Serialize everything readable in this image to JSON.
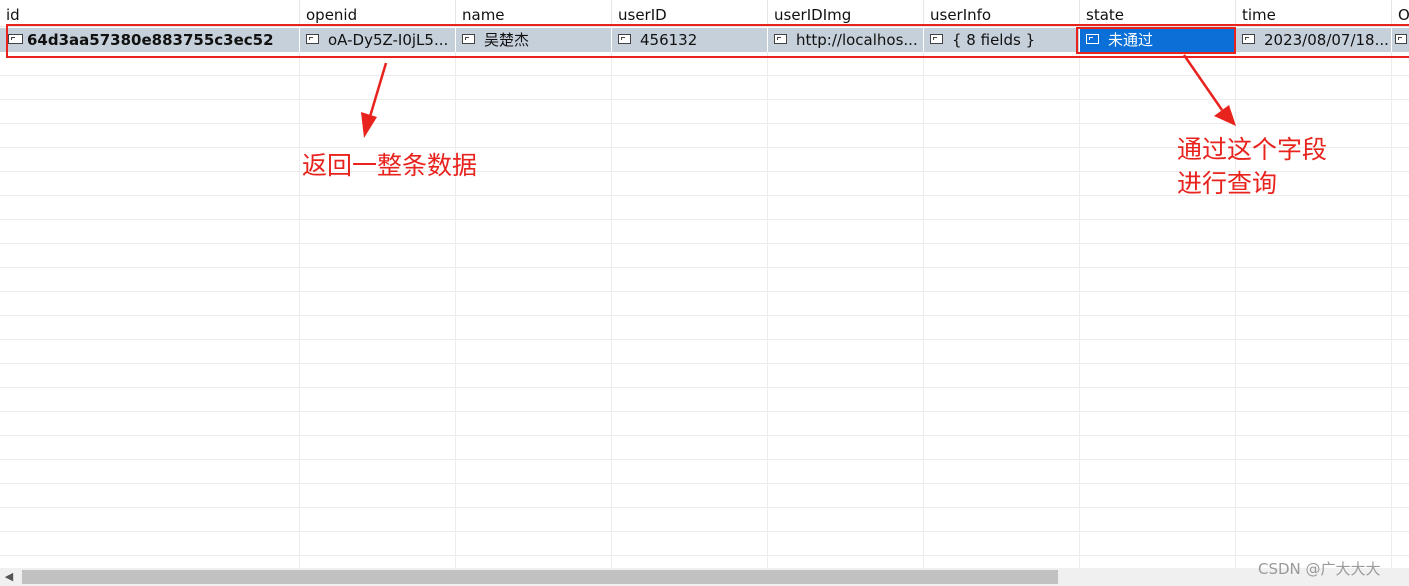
{
  "grid": {
    "columns": [
      "id",
      "openid",
      "name",
      "userID",
      "userIDImg",
      "userInfo",
      "state",
      "time",
      "O"
    ],
    "row": {
      "id": "64d3aa57380e883755c3ec52",
      "openid": "oA-Dy5Z-I0jL5...",
      "name": "吴楚杰",
      "userID": "456132",
      "userIDImg": "http://localhos...",
      "userInfo": "{ 8 fields }",
      "state": "未通过",
      "time": "2023/08/07/18..."
    }
  },
  "annotations": {
    "left": "返回一整条数据",
    "right_line1": "通过这个字段",
    "right_line2": "进行查询"
  },
  "colors": {
    "annotation": "#e8231e",
    "selection": "#0a6fd6",
    "row_highlight": "#c6d0da"
  },
  "watermark": "CSDN @广大大大"
}
